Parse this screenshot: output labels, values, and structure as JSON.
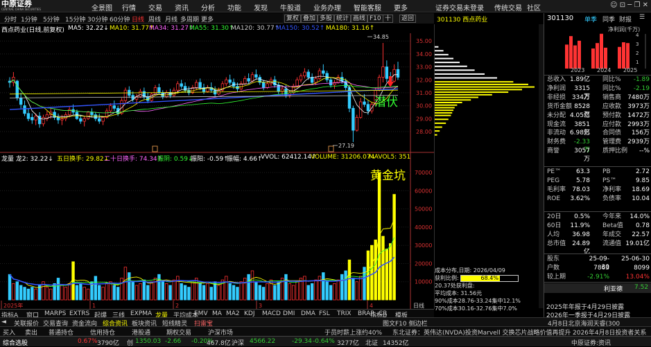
{
  "app": {
    "logo": "中原证券",
    "logo_sub": "CENTRAL CHINA SECURITIES",
    "menu": [
      "全景图",
      "行情",
      "交易",
      "资讯",
      "分析",
      "功能",
      "发现",
      "牛股道",
      "业务办理",
      "智能客服",
      "更多"
    ],
    "status": "证券交易未登录",
    "links": [
      "传统交易",
      "社区"
    ]
  },
  "toolbar": {
    "periods": [
      "分时",
      "1分钟",
      "5分钟",
      "15分钟",
      "30分钟",
      "60分钟",
      "日线",
      "周线",
      "月线",
      "多周期",
      "更多"
    ],
    "active": "日线",
    "right": [
      "复权",
      "叠加",
      "多股",
      "统计",
      "画线",
      "F10",
      "十",
      "返回"
    ]
  },
  "stock": {
    "code": "301130",
    "name": "西点药业",
    "title_bar": "301130 西点药业",
    "chart_title": "西点药业(日线,前复权)"
  },
  "ma": [
    {
      "label": "MA5: 32.22↓",
      "color": "#ffffff"
    },
    {
      "label": "MA10: 31.77↑",
      "color": "#ffff00"
    },
    {
      "label": "MA34: 31.27↑",
      "color": "#ff66ff"
    },
    {
      "label": "MA55: 31.30↑",
      "color": "#33ff33"
    },
    {
      "label": "MA120: 30.77↑",
      "color": "#c8c8c8"
    },
    {
      "label": "MA150: 30.52↑",
      "color": "#3355ff"
    },
    {
      "label": "MA180: 31.16↑",
      "color": "#ffff00"
    }
  ],
  "price_axis": [
    "35.00",
    "34.00",
    "33.00",
    "32.00",
    "31.00",
    "30.00",
    "29.00",
    "28.00"
  ],
  "price_marks": {
    "high": "34.85",
    "low": "27.19"
  },
  "annot": {
    "qianfu": "潜伏",
    "huangjinkeng": "黄金坑"
  },
  "vol_header": [
    {
      "label": "龙量 龙2: 32.22↓",
      "color": "#ffffff"
    },
    {
      "label": "五日换手: 29.82↓",
      "color": "#ffff00"
    },
    {
      "label": "二十日换手: 74.34↑",
      "color": "#ff66ff"
    },
    {
      "label": "振阴: 0.59↓",
      "color": "#33ff33"
    },
    {
      "label": "振阳: -0.59↑",
      "color": "#ffffff"
    },
    {
      "label": "振幅: 4.66↑",
      "color": "#ffffff"
    },
    {
      "label": "VVOL: 62412.14↑",
      "color": "#ffffff"
    },
    {
      "label": "VOLUME: 31206.07↓",
      "color": "#ffff00"
    },
    {
      "label": "MAVOL5: 351",
      "color": "#ffff00"
    }
  ],
  "vol_axis": [
    "70000",
    "60000",
    "50000",
    "40000",
    "30000",
    "20000",
    "10000"
  ],
  "date_axis": [
    "2025年",
    "1",
    "2",
    "3",
    "4"
  ],
  "time_axis_label": "日线",
  "chart_data": {
    "type": "candlestick",
    "ylim": [
      26.5,
      35.6
    ],
    "candles": [
      [
        31.9,
        32.2,
        31.4,
        31.8
      ],
      [
        31.8,
        32.6,
        31.5,
        32.2
      ],
      [
        31.9,
        32.0,
        30.4,
        30.6
      ],
      [
        30.6,
        31.0,
        29.8,
        30.1
      ],
      [
        30.0,
        30.4,
        29.2,
        29.4
      ],
      [
        29.4,
        29.8,
        28.8,
        29.0
      ],
      [
        29.1,
        29.4,
        28.6,
        28.9
      ],
      [
        28.9,
        29.4,
        28.5,
        29.2
      ],
      [
        29.2,
        29.5,
        28.3,
        28.6
      ],
      [
        28.6,
        29.3,
        28.4,
        29.1
      ],
      [
        29.0,
        29.6,
        28.8,
        29.3
      ],
      [
        29.3,
        29.8,
        29.0,
        29.5
      ],
      [
        29.5,
        29.7,
        28.9,
        29.1
      ],
      [
        29.1,
        29.4,
        28.6,
        28.9
      ],
      [
        28.9,
        29.3,
        28.5,
        29.0
      ],
      [
        29.0,
        29.5,
        28.8,
        29.3
      ],
      [
        29.3,
        29.9,
        29.1,
        29.7
      ],
      [
        29.7,
        30.1,
        29.3,
        29.5
      ],
      [
        29.5,
        29.7,
        28.9,
        29.0
      ],
      [
        29.0,
        29.3,
        28.6,
        28.8
      ],
      [
        28.8,
        29.2,
        28.4,
        29.0
      ],
      [
        29.0,
        29.6,
        28.9,
        29.5
      ],
      [
        29.5,
        29.8,
        29.1,
        29.3
      ],
      [
        29.3,
        29.5,
        28.8,
        29.0
      ],
      [
        29.0,
        29.4,
        28.6,
        28.8
      ],
      [
        28.8,
        29.2,
        28.5,
        29.1
      ],
      [
        29.1,
        29.8,
        29.0,
        29.6
      ],
      [
        29.6,
        30.2,
        29.4,
        30.0
      ],
      [
        30.0,
        30.4,
        29.6,
        29.8
      ],
      [
        29.8,
        30.0,
        29.2,
        29.4
      ],
      [
        29.4,
        30.6,
        29.3,
        30.4
      ],
      [
        30.4,
        31.4,
        30.2,
        31.2
      ],
      [
        31.2,
        31.5,
        30.6,
        30.8
      ],
      [
        30.8,
        31.1,
        30.3,
        30.5
      ],
      [
        30.5,
        30.9,
        30.1,
        30.7
      ],
      [
        30.7,
        31.3,
        30.6,
        31.1
      ],
      [
        31.1,
        31.4,
        30.5,
        30.7
      ],
      [
        30.7,
        31.0,
        30.2,
        30.4
      ],
      [
        30.4,
        31.0,
        30.3,
        30.9
      ],
      [
        30.9,
        31.6,
        30.8,
        31.4
      ],
      [
        31.4,
        31.7,
        30.9,
        31.0
      ],
      [
        31.0,
        31.2,
        30.5,
        30.7
      ],
      [
        30.7,
        31.2,
        30.6,
        31.0
      ],
      [
        31.0,
        31.3,
        30.6,
        30.8
      ],
      [
        30.8,
        31.4,
        30.7,
        31.2
      ],
      [
        31.2,
        31.9,
        31.0,
        31.7
      ],
      [
        31.7,
        32.0,
        31.3,
        31.5
      ],
      [
        31.5,
        31.8,
        31.0,
        31.2
      ],
      [
        31.2,
        31.5,
        30.8,
        31.0
      ],
      [
        31.0,
        31.6,
        30.9,
        31.4
      ],
      [
        31.4,
        32.0,
        31.2,
        31.8
      ],
      [
        31.8,
        32.1,
        31.2,
        31.4
      ],
      [
        31.4,
        31.7,
        30.9,
        31.1
      ],
      [
        31.1,
        31.6,
        31.0,
        31.4
      ],
      [
        31.4,
        31.8,
        31.0,
        31.2
      ],
      [
        31.2,
        31.5,
        30.7,
        30.9
      ],
      [
        30.9,
        31.4,
        30.8,
        31.2
      ],
      [
        31.2,
        31.9,
        31.1,
        31.7
      ],
      [
        31.7,
        32.2,
        31.5,
        32.0
      ],
      [
        32.0,
        32.4,
        31.6,
        31.8
      ],
      [
        31.8,
        32.1,
        31.3,
        31.5
      ],
      [
        31.5,
        31.8,
        31.1,
        31.3
      ],
      [
        31.3,
        31.9,
        31.2,
        31.7
      ],
      [
        31.7,
        32.3,
        31.6,
        32.1
      ],
      [
        32.1,
        32.5,
        31.7,
        31.9
      ],
      [
        31.9,
        32.6,
        31.8,
        32.4
      ],
      [
        32.4,
        32.8,
        32.0,
        32.2
      ],
      [
        32.2,
        32.4,
        31.6,
        31.8
      ],
      [
        31.8,
        32.0,
        31.2,
        31.4
      ],
      [
        31.4,
        31.9,
        31.3,
        31.7
      ],
      [
        31.7,
        32.2,
        31.5,
        32.0
      ],
      [
        32.0,
        32.3,
        31.4,
        31.6
      ],
      [
        31.6,
        31.8,
        30.9,
        31.1
      ],
      [
        31.1,
        31.5,
        30.8,
        31.3
      ],
      [
        31.3,
        31.6,
        30.6,
        30.8
      ],
      [
        30.8,
        31.2,
        30.6,
        31.0
      ],
      [
        31.0,
        31.7,
        30.9,
        31.5
      ],
      [
        31.5,
        32.2,
        31.4,
        32.0
      ],
      [
        32.0,
        32.5,
        31.8,
        32.3
      ],
      [
        32.3,
        32.9,
        32.1,
        32.6
      ],
      [
        32.6,
        32.8,
        32.0,
        32.2
      ],
      [
        32.2,
        32.5,
        31.6,
        31.8
      ],
      [
        31.8,
        32.3,
        31.6,
        32.1
      ],
      [
        32.1,
        32.9,
        32.0,
        32.7
      ],
      [
        32.7,
        33.2,
        32.3,
        32.5
      ],
      [
        32.5,
        32.7,
        31.8,
        32.0
      ],
      [
        32.0,
        32.2,
        31.4,
        31.6
      ],
      [
        31.6,
        32.0,
        31.3,
        31.8
      ],
      [
        31.8,
        32.4,
        31.7,
        32.2
      ],
      [
        32.2,
        32.6,
        31.7,
        31.9
      ],
      [
        31.9,
        32.1,
        31.2,
        31.4
      ],
      [
        31.4,
        31.6,
        29.5,
        29.8
      ],
      [
        29.8,
        30.0,
        27.19,
        28.1
      ],
      [
        28.1,
        29.3,
        28.0,
        29.1
      ],
      [
        29.1,
        30.6,
        29.0,
        30.3
      ],
      [
        30.3,
        30.9,
        29.9,
        30.1
      ],
      [
        30.1,
        30.4,
        29.3,
        29.6
      ],
      [
        29.6,
        30.3,
        29.4,
        30.1
      ],
      [
        30.1,
        31.4,
        30.0,
        31.2
      ],
      [
        31.2,
        32.4,
        31.1,
        32.2
      ],
      [
        32.2,
        34.85,
        31.8,
        33.0
      ],
      [
        33.0,
        33.5,
        31.8,
        32.1
      ],
      [
        32.1,
        32.6,
        31.6,
        31.9
      ],
      [
        31.9,
        33.2,
        31.8,
        32.8
      ],
      [
        32.8,
        33.4,
        32.0,
        32.2
      ]
    ],
    "volumes": [
      14,
      9,
      10,
      8,
      7,
      6,
      7,
      6,
      8,
      10,
      7,
      6,
      9,
      12,
      8,
      7,
      9,
      21,
      8,
      9,
      7,
      6,
      10,
      13,
      8,
      7,
      9,
      10,
      8,
      7,
      12,
      18,
      15,
      10,
      8,
      9,
      11,
      8,
      10,
      12,
      14,
      10,
      9,
      8,
      11,
      13,
      9,
      8,
      7,
      10,
      12,
      9,
      8,
      9,
      7,
      10,
      8,
      11,
      13,
      9,
      8,
      7,
      10,
      12,
      14,
      16,
      10,
      8,
      7,
      9,
      11,
      8,
      10,
      12,
      14,
      9,
      8,
      10,
      12,
      13,
      8,
      9,
      11,
      13,
      15,
      10,
      8,
      9,
      11,
      14,
      16,
      22,
      12,
      10,
      13,
      18,
      27,
      30,
      33,
      70,
      35,
      28,
      31,
      58
    ]
  },
  "dist_info": {
    "title": "成本分布,日期: 2026/04/09",
    "profit_label": "获利比例:",
    "profit": "68.4%",
    "profit_value": 68.4,
    "cost_profit": "20.37处获利盘:",
    "avg": "平均成本: 31.56元",
    "c90": "90%成本28.76-33.24集中12.1%",
    "c70": "70%成本30.16-32.76集中7.0%"
  },
  "right": {
    "code": "301130",
    "tabs": [
      "单季",
      "同季",
      "财报"
    ],
    "chart_title": "净利润(千万)",
    "years": [
      "2023",
      "2024",
      "2025"
    ],
    "fin": [
      [
        "总收入",
        "1.89亿",
        "同比%",
        "-1.89"
      ],
      [
        "净利润",
        "3315万",
        "同比%",
        "-2.19"
      ],
      [
        "非经损",
        "334万",
        "销售商",
        "7480万"
      ],
      [
        "货币金额",
        "8528万",
        "应收款",
        "3973万"
      ],
      [
        "未分配",
        "4.05亿",
        "预付款",
        "1472万"
      ],
      [
        "现金流",
        "3851万",
        "应付款",
        "2993万"
      ],
      [
        "非流动",
        "6.98亿",
        "合同债",
        "156万"
      ],
      [
        "财务费",
        "-2.33万",
        "管理费",
        "2939万"
      ],
      [
        "商誉",
        "3057万",
        "质押比例",
        "--%"
      ]
    ],
    "val": [
      [
        "PE™",
        "63.3",
        "PB",
        "2.72"
      ],
      [
        "PEG",
        "5.78",
        "PS™",
        "9.85"
      ],
      [
        "毛利率",
        "78.03",
        "净利率",
        "18.69"
      ],
      [
        "ROE",
        "3.62%",
        "负债率",
        "10.04"
      ]
    ],
    "perf": [
      [
        "20日",
        "0.5%",
        "今年来",
        "14.0%"
      ],
      [
        "60日",
        "11.9%",
        "Beta值",
        "0.78"
      ],
      [
        "人均",
        "36.98",
        "年成交",
        "22.57"
      ],
      [
        "总市值",
        "24.89亿",
        "流通值",
        "19.01亿"
      ]
    ],
    "holders": [
      [
        "股东",
        "25-09-30",
        "25-06-30"
      ],
      [
        "户数",
        "7863",
        "8099"
      ],
      [
        "较上期",
        "-2.91%",
        "13.04%"
      ]
    ],
    "bottom_name": "利亚德",
    "bottom_val": "7.52",
    "news": [
      "4月8日北京海润天睿(300",
      "2025年年报于4月29日披露",
      "2026年一季报于4月29日披露"
    ]
  },
  "tabs": [
    "指标A",
    "窗口",
    "MARPS",
    "EXTRS",
    "起爆",
    "三线",
    "EXPMA",
    "龙量",
    "平均成本",
    "EMV",
    "MA",
    "MA2",
    "KDJ",
    "MACD",
    "DMI",
    "DMA",
    "FSL",
    "TRIX",
    "BRAR",
    "CR",
    "指标B",
    "模板"
  ],
  "tab_selected": "龙量",
  "row2": [
    "关联报价",
    "交易查询",
    "资金流向",
    "综合资讯",
    "板块资讯",
    "短线精灵",
    "扫雷宝"
  ],
  "row2_right": "图文F10 侧边栏",
  "row3": [
    "买入",
    "卖出",
    "普通持仓",
    "信用持仓",
    "港股通",
    "期权交易",
    "沪深市场",
    "于员时薪上涨约40%",
    "东北证券：英伟达(NVDA)投资Marvell 交换芯片战略价值再提升",
    "2026年4月8日投资者关系活动"
  ],
  "row4": [
    {
      "t": "综合选股",
      "c": "#fff"
    },
    {
      "t": "0.67%",
      "c": "#f33"
    },
    {
      "t": "3790亿",
      "c": "#ccc"
    },
    {
      "t": "创",
      "c": "#ccc"
    },
    {
      "t": "1350.03",
      "c": "#3c3"
    },
    {
      "t": "-2.66",
      "c": "#3c3"
    },
    {
      "t": "-0.20%",
      "c": "#3c3"
    },
    {
      "t": "467.8亿",
      "c": "#ccc"
    },
    {
      "t": "沪深",
      "c": "#ccc"
    },
    {
      "t": "4566.22",
      "c": "#3c3"
    },
    {
      "t": "-29.34",
      "c": "#3c3"
    },
    {
      "t": "-0.64%",
      "c": "#3c3"
    },
    {
      "t": "3277亿",
      "c": "#ccc"
    },
    {
      "t": "北证",
      "c": "#ccc"
    },
    {
      "t": "14352亿",
      "c": "#ccc"
    },
    {
      "t": "中原证券:资讯",
      "c": "#ccc"
    }
  ]
}
